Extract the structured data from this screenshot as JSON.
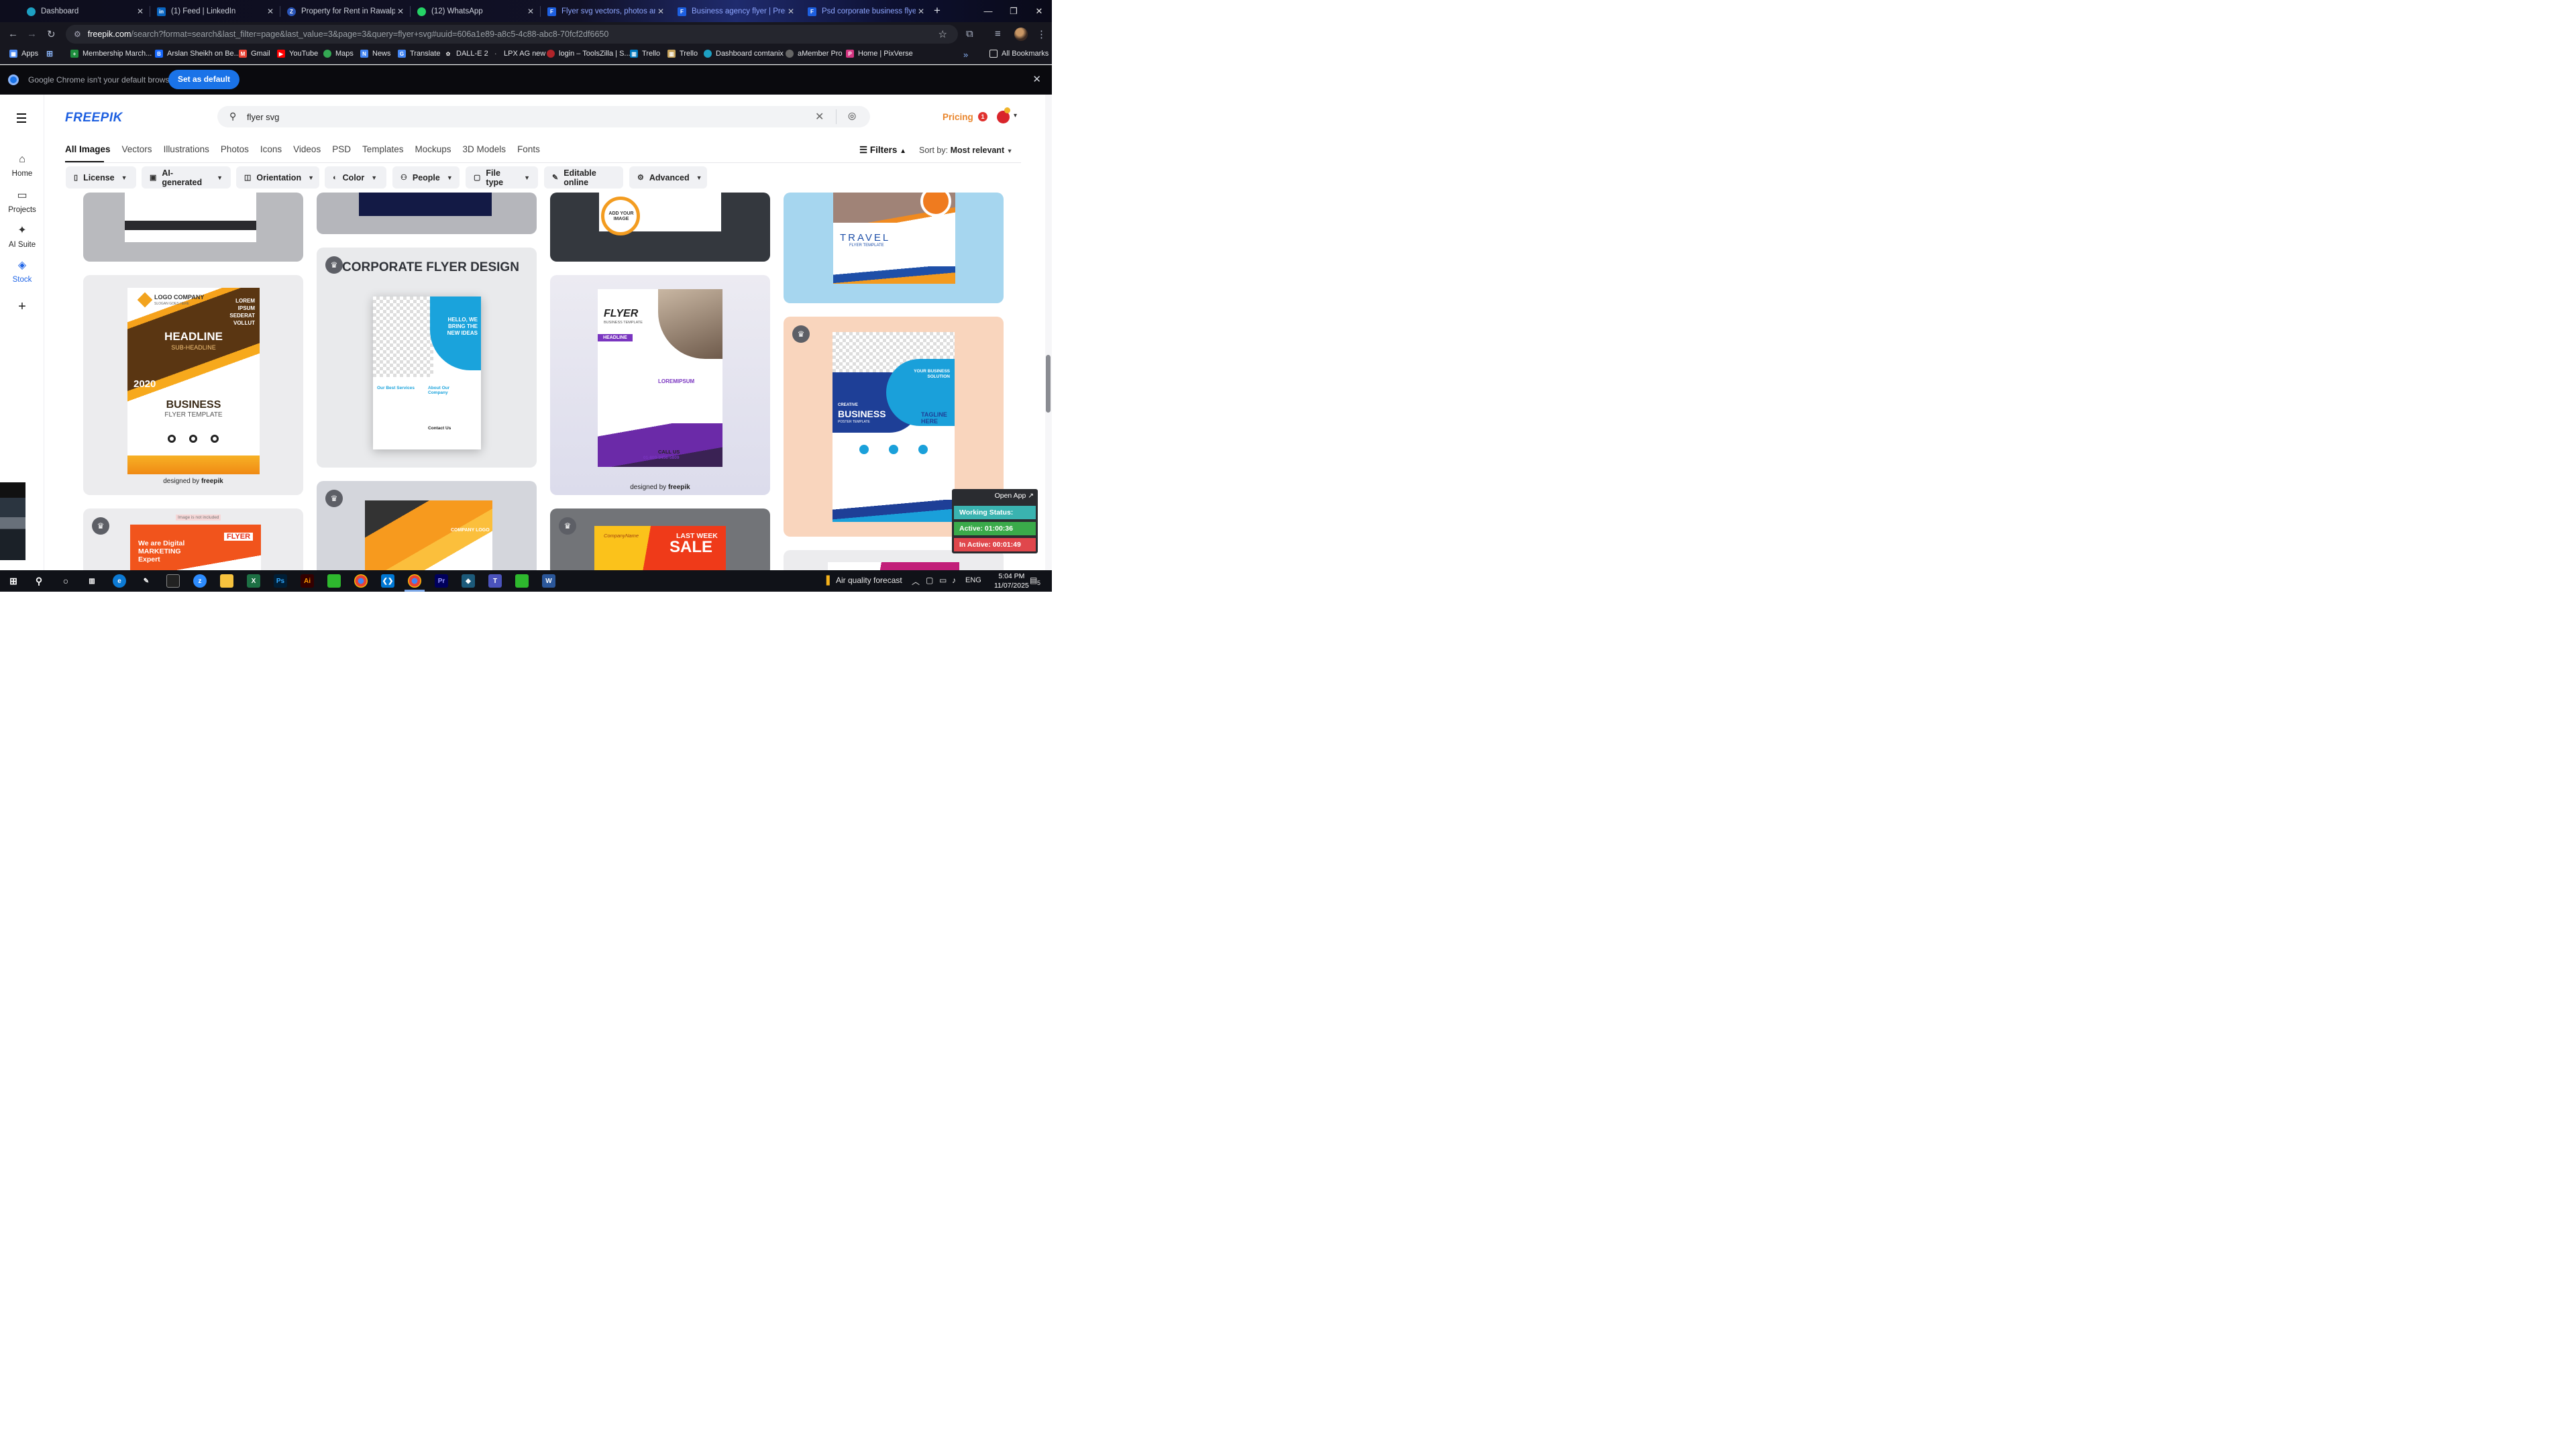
{
  "browser": {
    "tabs": [
      {
        "title": "Dashboard",
        "color": "#1da0c3",
        "letter": ""
      },
      {
        "title": "(1) Feed | LinkedIn",
        "color": "#0a66c2",
        "letter": "in"
      },
      {
        "title": "Property for Rent in Rawalpindi",
        "color": "#2a55b8",
        "letter": "ZS"
      },
      {
        "title": "(12) WhatsApp",
        "color": "#25d366",
        "letter": ""
      },
      {
        "title": "Flyer svg vectors, photos and P",
        "color": "#1d5fe0",
        "letter": "F"
      },
      {
        "title": "Business agency flyer | Premium",
        "color": "#1d5fe0",
        "letter": "F"
      },
      {
        "title": "Psd corporate business flyer de",
        "color": "#1d5fe0",
        "letter": "F"
      }
    ],
    "url_domain": "freepik.com",
    "url_path": "/search?format=search&last_filter=page&last_value=3&page=3&query=flyer+svg#uuid=606a1e89-a8c5-4c88-abc8-70fcf2df6650",
    "bookmarks": [
      "Apps",
      "Membership March...",
      "Arslan Sheikh on Be...",
      "Gmail",
      "YouTube",
      "Maps",
      "News",
      "Translate",
      "DALL-E 2",
      "LPX AG new",
      "login – ToolsZilla | S...",
      "Trello",
      "Trello",
      "Dashboard comtanix",
      "aMember Pro",
      "Home | PixVerse"
    ],
    "all_bookmarks": "All Bookmarks",
    "infobar_text": "Google Chrome isn't your default browser",
    "infobar_button": "Set as default"
  },
  "freepik": {
    "logo": "FREEPIK",
    "nav": [
      "Home",
      "Projects",
      "AI Suite",
      "Stock"
    ],
    "search_value": "flyer svg",
    "pricing": "Pricing",
    "notifications": "1",
    "categories": [
      "All Images",
      "Vectors",
      "Illustrations",
      "Photos",
      "Icons",
      "Videos",
      "PSD",
      "Templates",
      "Mockups",
      "3D Models",
      "Fonts"
    ],
    "filters_label": "Filters",
    "sort_label": "Sort by:",
    "sort_value": "Most relevant",
    "chips": [
      "License",
      "AI-generated",
      "Orientation",
      "Color",
      "People",
      "File type",
      "Editable online",
      "Advanced"
    ],
    "cards": {
      "c1_headline": "HEADLINE",
      "c1_sub": "SUB-HEADLINE",
      "c1_logo": "LOGO COMPANY",
      "c1_slogan": "SLOGAN GOES HERE",
      "c1_lorem": "LOREM IPSUM SEDERAT VOLLUT",
      "c1_year": "2020",
      "c1_business": "BUSINESS",
      "c1_template": "FLYER TEMPLATE",
      "designed_by": "designed by",
      "freepik": "freepik",
      "c2_title": "CORPORATE FLYER DESIGN",
      "c2_hello": "HELLO, WE BRING THE NEW IDEAS",
      "c2_services": "Our Best Services",
      "c2_about": "About Our Company",
      "c2_contact": "Contact Us",
      "c3_flyer": "FLYER",
      "c3_template": "BUSINESS TEMPLATE",
      "c3_headline": "HEADLINE",
      "c3_lorem": "LOREMIPSUM",
      "c3_call": "CALL US",
      "c3_phone": "01-800-3456-5809",
      "c3_add": "ADD YOUR IMAGE",
      "c4_travel": "TRAVEL",
      "c4_template": "FLYER TEMPLATE",
      "c4_creative": "CREATIVE",
      "c4_business": "BUSINESS",
      "c4_poster": "POSTER TEMPLATE",
      "c4_tagline": "TAGLINE HERE",
      "c4_solution": "YOUR BUSINESS SOLUTION",
      "c5_flyer": "FLYER",
      "c5_marketing": "We are Digital MARKETING Expert",
      "c5_notincluded": "Image is not included",
      "c6_company": "COMPANY LOGO",
      "c7_company": "CompanyName",
      "c7_last": "LAST WEEK",
      "c7_sale": "SALE"
    }
  },
  "tracker": {
    "open_app": "Open App ↗",
    "status": "Working Status: Active",
    "active": "Active: 01:00:36",
    "inactive": "In Active: 00:01:49"
  },
  "taskbar": {
    "weather": "Air quality forecast",
    "lang": "ENG",
    "time": "5:04 PM",
    "date": "11/07/2025",
    "notif_count": "5"
  }
}
